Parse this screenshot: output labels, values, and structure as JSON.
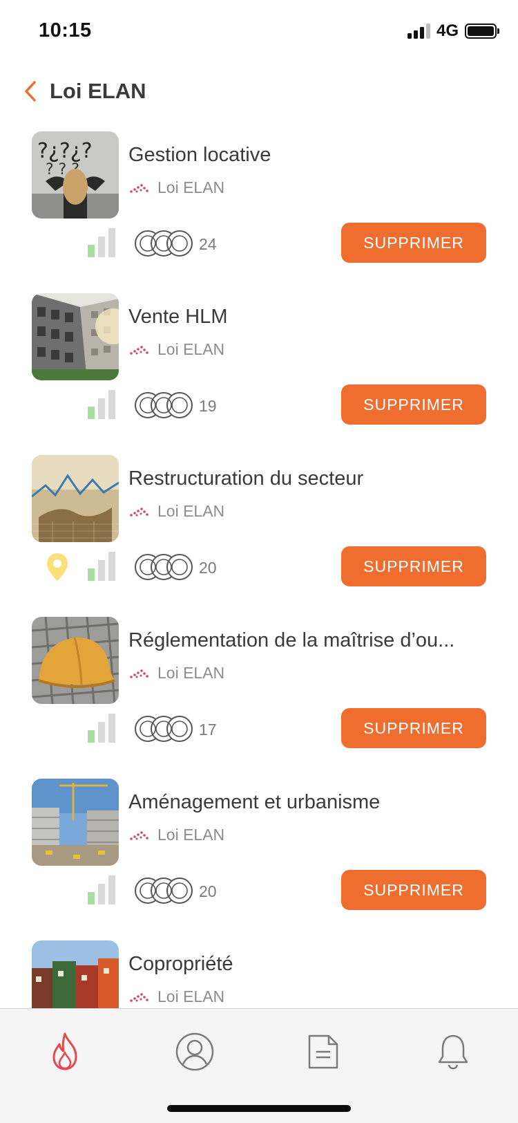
{
  "status_bar": {
    "time": "10:15",
    "network": "4G"
  },
  "header": {
    "title": "Loi ELAN",
    "back_icon": "chevron-left-icon"
  },
  "colors": {
    "accent": "#ee6d2f",
    "level_active": "#a9dea0",
    "level_inactive": "#d8d8d8",
    "pin": "#fbe07a",
    "tab_active": "#e5484d"
  },
  "courses": [
    {
      "title": "Gestion locative",
      "subtitle": "Loi ELAN",
      "count": "24",
      "button": "SUPPRIMER",
      "has_pin": false
    },
    {
      "title": "Vente HLM",
      "subtitle": "Loi ELAN",
      "count": "19",
      "button": "SUPPRIMER",
      "has_pin": false
    },
    {
      "title": "Restructuration du secteur",
      "subtitle": "Loi ELAN",
      "count": "20",
      "button": "SUPPRIMER",
      "has_pin": true
    },
    {
      "title": "Réglementation de la maîtrise d’ou...",
      "subtitle": "Loi ELAN",
      "count": "17",
      "button": "SUPPRIMER",
      "has_pin": false
    },
    {
      "title": "Aménagement et urbanisme",
      "subtitle": "Loi ELAN",
      "count": "20",
      "button": "SUPPRIMER",
      "has_pin": false
    },
    {
      "title": "Copropriété",
      "subtitle": "Loi ELAN",
      "count": "",
      "button": "",
      "has_pin": false
    }
  ],
  "tab_bar": [
    {
      "name": "flame-icon",
      "active": true
    },
    {
      "name": "profile-icon",
      "active": false
    },
    {
      "name": "document-icon",
      "active": false
    },
    {
      "name": "bell-icon",
      "active": false
    }
  ]
}
